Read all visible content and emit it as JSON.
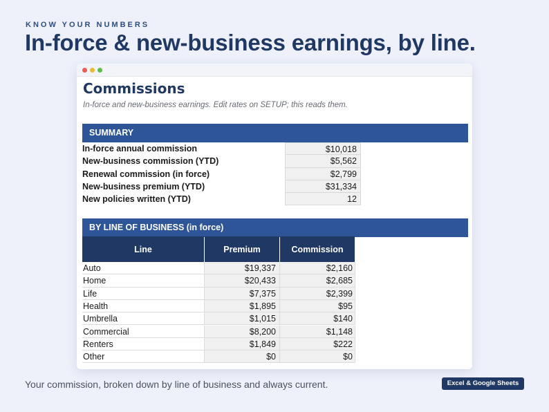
{
  "eyebrow": "KNOW YOUR NUMBERS",
  "headline": "In-force & new-business earnings, by line.",
  "sheet": {
    "title": "Commissions",
    "subtitle": "In-force and new-business earnings. Edit rates on SETUP; this reads them.",
    "summary_header": "SUMMARY",
    "summary": [
      {
        "label": "In-force annual commission",
        "value": "$10,018"
      },
      {
        "label": "New-business commission (YTD)",
        "value": "$5,562"
      },
      {
        "label": "Renewal commission (in force)",
        "value": "$2,799"
      },
      {
        "label": "New-business premium (YTD)",
        "value": "$31,334"
      },
      {
        "label": "New policies written (YTD)",
        "value": "12"
      }
    ],
    "lob_header": "BY LINE OF BUSINESS  (in force)",
    "columns": {
      "line": "Line",
      "premium": "Premium",
      "commission": "Commission"
    },
    "rows": [
      {
        "line": "Auto",
        "premium": "$19,337",
        "commission": "$2,160"
      },
      {
        "line": "Home",
        "premium": "$20,433",
        "commission": "$2,685"
      },
      {
        "line": "Life",
        "premium": "$7,375",
        "commission": "$2,399"
      },
      {
        "line": "Health",
        "premium": "$1,895",
        "commission": "$95"
      },
      {
        "line": "Umbrella",
        "premium": "$1,015",
        "commission": "$140"
      },
      {
        "line": "Commercial",
        "premium": "$8,200",
        "commission": "$1,148"
      },
      {
        "line": "Renters",
        "premium": "$1,849",
        "commission": "$222"
      },
      {
        "line": "Other",
        "premium": "$0",
        "commission": "$0"
      }
    ]
  },
  "caption": "Your commission, broken down by line of business and always current.",
  "badge": "Excel & Google Sheets",
  "colors": {
    "accent_band": "#2e5597",
    "header_navy": "#1f3864",
    "background": "#eef1fa"
  }
}
